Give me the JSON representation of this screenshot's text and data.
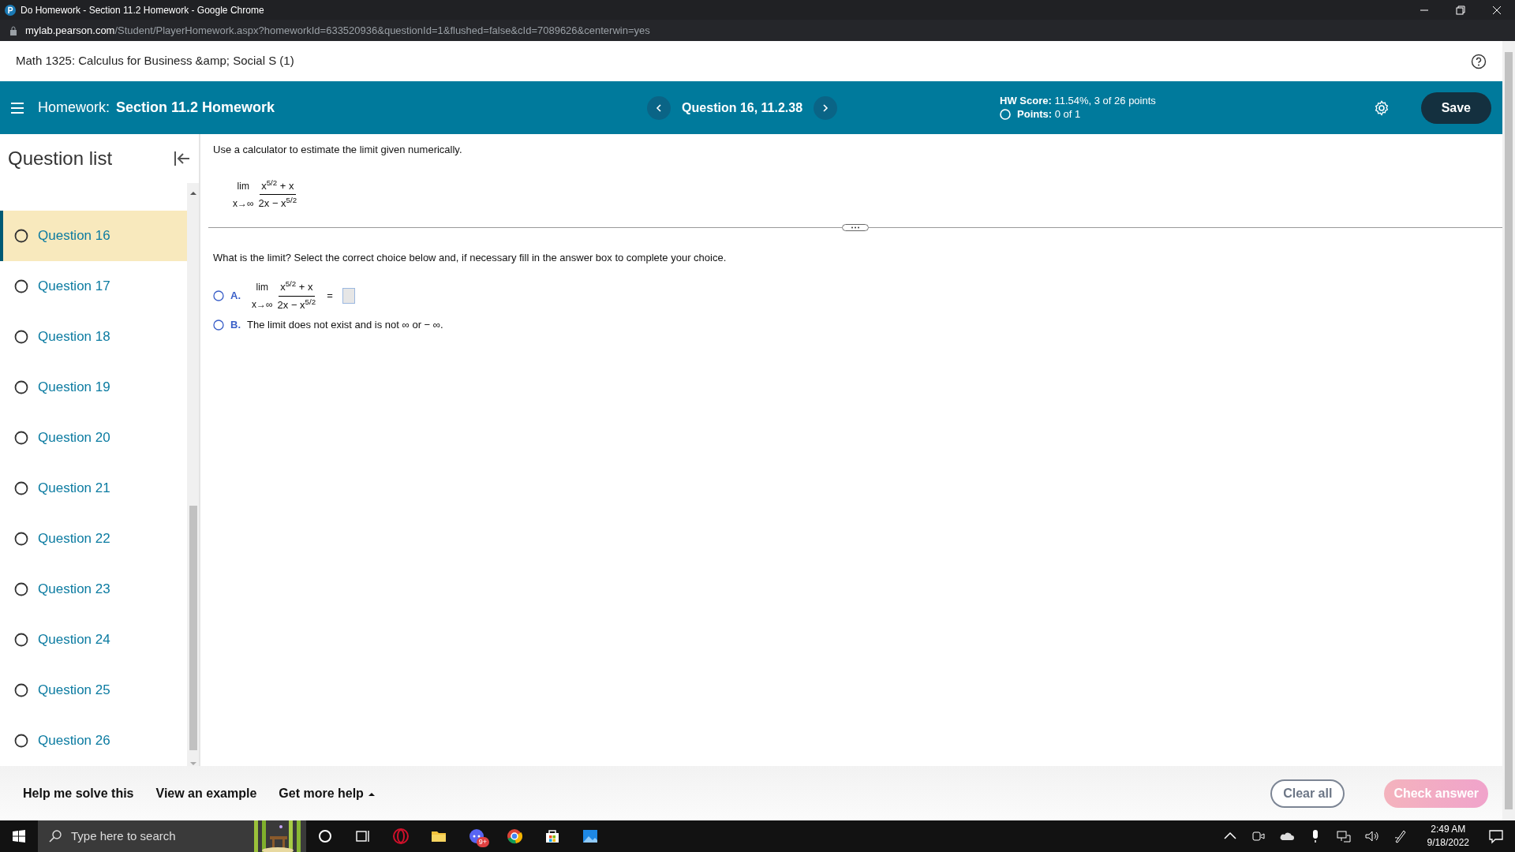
{
  "browser": {
    "title": "Do Homework - Section 11.2 Homework - Google Chrome",
    "url_host": "mylab.pearson.com",
    "url_path": "/Student/PlayerHomework.aspx?homeworkId=633520936&questionId=1&flushed=false&cId=7089626&centerwin=yes"
  },
  "course_title": "Math 1325: Calculus for Business &amp; Social S (1)",
  "header": {
    "label": "Homework:",
    "name": "Section 11.2 Homework",
    "question": "Question 16, 11.2.38",
    "score_label": "HW Score:",
    "score": "11.54%, 3 of 26 points",
    "points_label": "Points:",
    "points": "0 of 1",
    "save": "Save"
  },
  "sidebar": {
    "title": "Question list",
    "items": [
      {
        "label": "Question 16",
        "selected": true
      },
      {
        "label": "Question 17",
        "selected": false
      },
      {
        "label": "Question 18",
        "selected": false
      },
      {
        "label": "Question 19",
        "selected": false
      },
      {
        "label": "Question 20",
        "selected": false
      },
      {
        "label": "Question 21",
        "selected": false
      },
      {
        "label": "Question 22",
        "selected": false
      },
      {
        "label": "Question 23",
        "selected": false
      },
      {
        "label": "Question 24",
        "selected": false
      },
      {
        "label": "Question 25",
        "selected": false
      },
      {
        "label": "Question 26",
        "selected": false
      }
    ]
  },
  "question": {
    "instruction": "Use a calculator to estimate the limit given numerically.",
    "expression": {
      "lim": "lim",
      "approach": "x→∞",
      "numerator": "x$^{5/2}$ + x",
      "denominator": "2x − x$^{5/2}$"
    },
    "prompt": "What is the limit? Select the correct choice below and, if necessary fill in the answer box to complete your choice.",
    "choices": [
      {
        "kind": "expression",
        "letter": "A.",
        "selected": false,
        "lim": "lim",
        "approach": "x→∞",
        "numerator": "x$^{5/2}$ + x",
        "denominator": "2x − x$^{5/2}$",
        "equals": "="
      },
      {
        "kind": "text",
        "letter": "B.",
        "selected": false,
        "text": "The limit does not exist and is not ∞ or − ∞."
      }
    ]
  },
  "footer": {
    "links": [
      "Help me solve this",
      "View an example",
      "Get more help"
    ],
    "clear": "Clear all",
    "check": {
      "label": "Check answer",
      "disabled": true
    }
  },
  "taskbar": {
    "search_placeholder": "Type here to search",
    "badge": "9+",
    "time": "2:49 AM",
    "date": "9/18/2022"
  }
}
